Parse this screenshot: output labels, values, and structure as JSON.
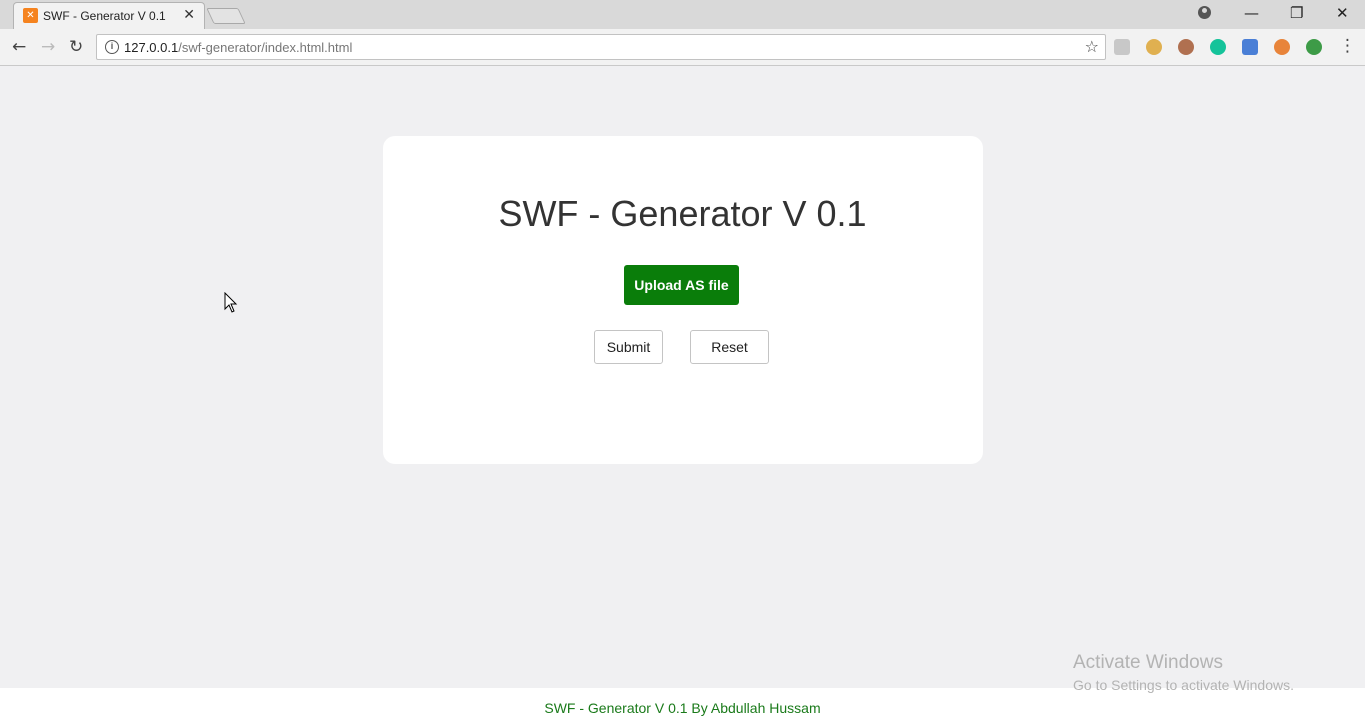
{
  "browser": {
    "tab_title": "SWF - Generator V 0.1",
    "tab_close": "✕",
    "url_host": "127.0.0.1",
    "url_path": "/swf-generator/index.html.html",
    "window_controls": {
      "minimize": "—",
      "restore": "❐",
      "close": "✕"
    },
    "nav": {
      "back": "←",
      "forward": "→",
      "reload": "↻"
    },
    "icons": [
      "profile-icon",
      "info-icon",
      "star-icon",
      "menu-icon"
    ],
    "extensions": [
      "pdf-extension-icon",
      "translate-extension-icon",
      "person-extension-icon",
      "grammarly-extension-icon",
      "google-translate-extension-icon",
      "tampermonkey-extension-icon",
      "globe-extension-icon"
    ]
  },
  "main": {
    "title": "SWF - Generator V 0.1",
    "upload_label": "Upload AS file",
    "submit_label": "Submit",
    "reset_label": "Reset"
  },
  "footer": {
    "text": "SWF - Generator V 0.1 By Abdullah Hussam"
  },
  "watermark": {
    "title": "Activate Windows",
    "subtitle": "Go to Settings to activate Windows."
  },
  "colors": {
    "upload_button": "#0a7d0a",
    "footer_text": "#1a7a1a",
    "page_background": "#f0f0f2"
  }
}
